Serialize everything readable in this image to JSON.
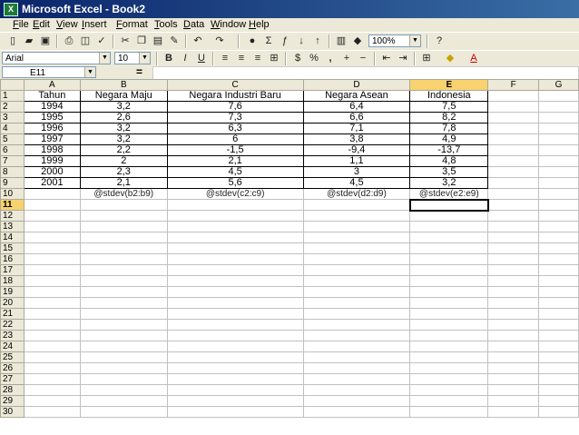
{
  "window": {
    "title": "Microsoft Excel - Book2",
    "icon": "excel-icon"
  },
  "menu": [
    "File",
    "Edit",
    "View",
    "Insert",
    "Format",
    "Tools",
    "Data",
    "Window",
    "Help"
  ],
  "toolbar": {
    "standard_icons": [
      "new-icon",
      "open-icon",
      "save-icon",
      "print-icon",
      "print-preview-icon",
      "spelling-icon",
      "cut-icon",
      "copy-icon",
      "paste-icon",
      "format-painter-icon",
      "undo-icon",
      "redo-icon",
      "hyperlink-icon",
      "autosum-icon",
      "function-icon",
      "sort-ascending-icon",
      "sort-descending-icon",
      "chart-wizard-icon",
      "drawing-icon",
      "help-icon"
    ],
    "zoom": "100%",
    "font_name": "Arial",
    "font_size": "10",
    "bold": "B",
    "italic": "I",
    "underline": "U",
    "currency": "%",
    "comma": ","
  },
  "formula_bar": {
    "name_box": "E11",
    "equals": "=",
    "content": ""
  },
  "columns": [
    "A",
    "B",
    "C",
    "D",
    "E",
    "F",
    "G"
  ],
  "rows": [
    [
      "Tahun",
      "Negara Maju",
      "Negara Industri Baru",
      "Negara Asean",
      "Indonesia",
      "",
      ""
    ],
    [
      "1994",
      "3,2",
      "7,6",
      "6,4",
      "7,5",
      "",
      ""
    ],
    [
      "1995",
      "2,6",
      "7,3",
      "6,6",
      "8,2",
      "",
      ""
    ],
    [
      "1996",
      "3,2",
      "6,3",
      "7,1",
      "7,8",
      "",
      ""
    ],
    [
      "1997",
      "3,2",
      "6",
      "3,8",
      "4,9",
      "",
      ""
    ],
    [
      "1998",
      "2,2",
      "-1,5",
      "-9,4",
      "-13,7",
      "",
      ""
    ],
    [
      "1999",
      "2",
      "2,1",
      "1,1",
      "4,8",
      "",
      ""
    ],
    [
      "2000",
      "2,3",
      "4,5",
      "3",
      "3,5",
      "",
      ""
    ],
    [
      "2001",
      "2,1",
      "5,6",
      "4,5",
      "3,2",
      "",
      ""
    ],
    [
      "",
      "@stdev(b2:b9)",
      "@stdev(c2:c9)",
      "@stdev(d2:d9)",
      "@stdev(e2:e9)",
      "",
      ""
    ]
  ],
  "row_numbers": [
    "1",
    "2",
    "3",
    "4",
    "5",
    "6",
    "7",
    "8",
    "9",
    "10",
    "11",
    "12",
    "13",
    "14",
    "15",
    "16",
    "17",
    "18",
    "19",
    "20",
    "21",
    "22",
    "23",
    "24",
    "25",
    "26",
    "27",
    "28",
    "29",
    "30"
  ],
  "active_cell": {
    "col": 4,
    "row": 10
  }
}
